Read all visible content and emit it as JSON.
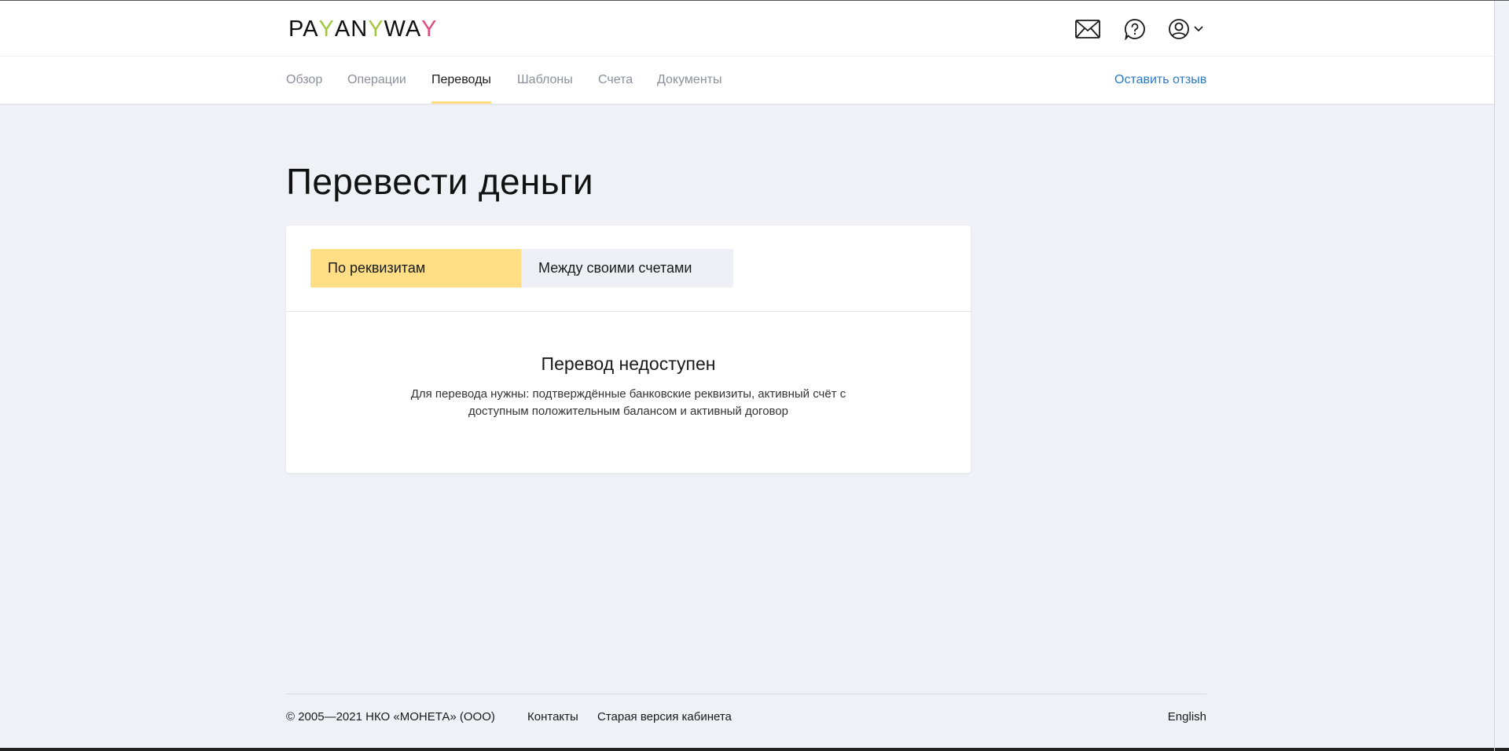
{
  "header": {
    "logo": {
      "p1": "PA",
      "y1": "Y",
      "p2": "AN",
      "y2": "Y",
      "p3": "WA",
      "y3": "Y"
    },
    "icons": [
      "mail-icon",
      "help-icon",
      "user-icon",
      "chevron-down-icon"
    ]
  },
  "nav": {
    "items": [
      {
        "label": "Обзор"
      },
      {
        "label": "Операции"
      },
      {
        "label": "Переводы"
      },
      {
        "label": "Шаблоны"
      },
      {
        "label": "Счета"
      },
      {
        "label": "Документы"
      }
    ],
    "active_index": 2,
    "feedback": "Оставить отзыв"
  },
  "main": {
    "title": "Перевести деньги",
    "tabs": [
      {
        "label": "По реквизитам"
      },
      {
        "label": "Между своими счетами"
      }
    ],
    "empty_title": "Перевод недоступен",
    "empty_text": "Для перевода нужны: подтверждённые банковские реквизиты, активный счёт с доступным положительным балансом и активный договор"
  },
  "footer": {
    "copyright": "© 2005—2021 НКО «МОНЕТА» (ООО)",
    "contacts": "Контакты",
    "old_version": "Старая версия кабинета",
    "language": "English"
  },
  "colors": {
    "accent_yellow": "#ffde85",
    "link_blue": "#2a78c8",
    "background": "#f0f1f6"
  }
}
